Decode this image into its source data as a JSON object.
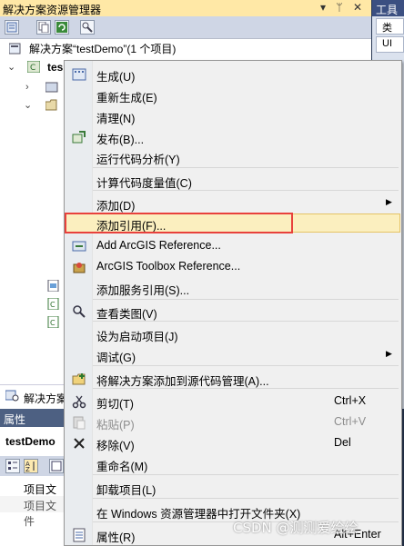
{
  "solution_explorer": {
    "title": "解决方案资源管理器",
    "title_buttons": "▾ ᛘ ✕",
    "solution_label": "解决方案“testDemo”(1 个项目)",
    "project_label": "tes",
    "bottom_tab": "解决方案"
  },
  "toolbox": {
    "title": "工具",
    "items": [
      "类",
      "UI"
    ]
  },
  "properties": {
    "title": "属性",
    "object_name": "testDemo",
    "rows": [
      "项目文件",
      "项目文件"
    ]
  },
  "context_menu": {
    "items": [
      {
        "label": "生成(U)",
        "icon": "build-icon"
      },
      {
        "label": "重新生成(E)"
      },
      {
        "label": "清理(N)"
      },
      {
        "label": "发布(B)...",
        "icon": "publish-icon"
      },
      {
        "label": "运行代码分析(Y)"
      },
      {
        "label": "计算代码度量值(C)"
      },
      {
        "label": "添加(D)",
        "submenu": true
      },
      {
        "label": "添加引用(F)...",
        "highlighted": true
      },
      {
        "label": "Add ArcGIS Reference...",
        "icon": "arcgis-reference-icon"
      },
      {
        "label": "ArcGIS Toolbox Reference...",
        "icon": "arcgis-toolbox-icon"
      },
      {
        "label": "添加服务引用(S)..."
      },
      {
        "label": "查看类图(V)",
        "icon": "class-diagram-icon"
      },
      {
        "label": "设为启动项目(J)"
      },
      {
        "label": "调试(G)",
        "submenu": true
      },
      {
        "label": "将解决方案添加到源代码管理(A)...",
        "icon": "source-control-icon"
      },
      {
        "label": "剪切(T)",
        "shortcut": "Ctrl+X",
        "icon": "cut-icon"
      },
      {
        "label": "粘贴(P)",
        "shortcut": "Ctrl+V",
        "icon": "paste-icon",
        "disabled": true
      },
      {
        "label": "移除(V)",
        "shortcut": "Del",
        "icon": "remove-icon"
      },
      {
        "label": "重命名(M)",
        "icon": "rename-icon"
      },
      {
        "label": "卸载项目(L)"
      },
      {
        "label": "在 Windows 资源管理器中打开文件夹(X)"
      },
      {
        "label": "属性(R)",
        "shortcut": "Alt+Enter",
        "icon": "properties-icon"
      }
    ]
  },
  "watermark": "CSDN @测测爱绘绘",
  "colors": {
    "highlight_fill": "#fbefbf",
    "highlight_border": "#e5c365",
    "annotation_red": "#e8413c",
    "title_gold": "#ffe8a6"
  }
}
